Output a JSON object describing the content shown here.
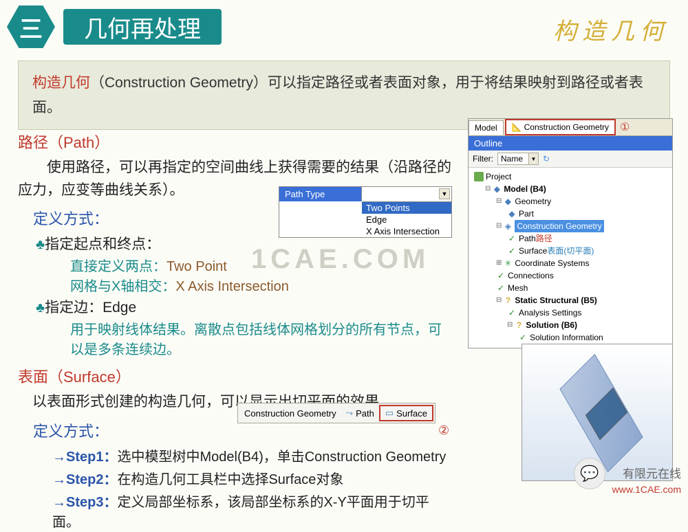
{
  "header": {
    "badge": "三",
    "title": "几何再处理",
    "right_title": "构造几何"
  },
  "intro": {
    "highlight": "构造几何",
    "rest": "（Construction Geometry）可以指定路径或者表面对象，用于将结果映射到路径或者表面。"
  },
  "path": {
    "title": "路径（Path）",
    "desc": "使用路径，可以再指定的空间曲线上获得需要的结果（沿路径的应力，应变等曲线关系）。",
    "def_title": "定义方式：",
    "b1": "指定起点和终点：",
    "b1a_g": "直接定义两点：",
    "b1a_v": "Two Point",
    "b1b_g": "网格与X轴相交：",
    "b1b_v": "X Axis Intersection",
    "b2": "指定边：Edge",
    "b2a": "用于映射线体结果。离散点包括线体网格划分的所有节点，可以是多条连续边。"
  },
  "surface": {
    "title": "表面（Surface）",
    "desc": "以表面形式创建的构造几何，可以显示出切平面的效果。",
    "def_title": "定义方式：",
    "step_lbl": [
      "Step1：",
      "Step2：",
      "Step3："
    ],
    "step1": "选中模型树中Model(B4)，单击Construction Geometry",
    "step2": "在构造几何工具栏中选择Surface对象",
    "step3": "定义局部坐标系，该局部坐标系的X-Y平面用于切平面。"
  },
  "dropdown": {
    "label": "Path Type",
    "options": [
      "Two Points",
      "Edge",
      "X Axis Intersection"
    ]
  },
  "tabs": {
    "model": "Model",
    "cg": "Construction Geometry",
    "circ1": "①"
  },
  "outline": {
    "title": "Outline",
    "filter_lbl": "Filter:",
    "filter_val": "Name",
    "tree": [
      {
        "lvl": 0,
        "ico": "proj",
        "text": "Project",
        "exp": ""
      },
      {
        "lvl": 1,
        "ico": "model",
        "text": "Model (B4)",
        "exp": "⊟",
        "bold": true
      },
      {
        "lvl": 2,
        "ico": "geom",
        "text": "Geometry",
        "exp": "⊟"
      },
      {
        "lvl": 3,
        "ico": "geom",
        "text": "Part",
        "exp": ""
      },
      {
        "lvl": 2,
        "ico": "cg",
        "text": "Construction Geometry",
        "exp": "⊟",
        "sel": true
      },
      {
        "lvl": 3,
        "ico": "check",
        "text": "Path",
        "exp": "",
        "extra_red": "路径"
      },
      {
        "lvl": 3,
        "ico": "check",
        "text": "Surface",
        "exp": "",
        "extra_blue": "表面(切平面)"
      },
      {
        "lvl": 2,
        "ico": "axes",
        "text": "Coordinate Systems",
        "exp": "⊞"
      },
      {
        "lvl": 2,
        "ico": "check",
        "text": "Connections",
        "exp": ""
      },
      {
        "lvl": 2,
        "ico": "check",
        "text": "Mesh",
        "exp": ""
      },
      {
        "lvl": 2,
        "ico": "q",
        "text": "Static Structural (B5)",
        "exp": "⊟",
        "bold": true
      },
      {
        "lvl": 3,
        "ico": "check",
        "text": "Analysis Settings",
        "exp": ""
      },
      {
        "lvl": 3,
        "ico": "q",
        "text": "Solution (B6)",
        "exp": "⊟",
        "bold": true
      },
      {
        "lvl": 4,
        "ico": "check",
        "text": "Solution Information",
        "exp": ""
      }
    ]
  },
  "cg_toolbar": {
    "label": "Construction Geometry",
    "path_btn": "Path",
    "surf_btn": "Surface",
    "circ2": "②"
  },
  "watermark": "1CAE.COM",
  "footer": {
    "text": "有限元在线",
    "url": "www.1CAE.com"
  }
}
